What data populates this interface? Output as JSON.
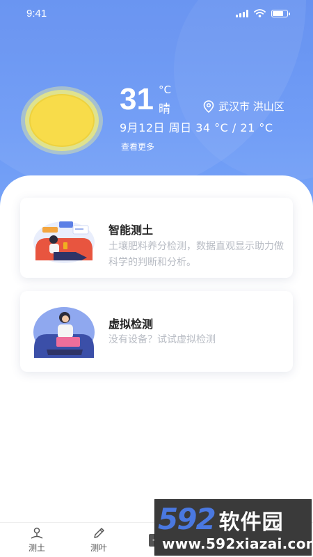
{
  "status_bar": {
    "time": "9:41",
    "battery_level": 0.8
  },
  "weather": {
    "temperature": "31",
    "unit": "°C",
    "condition": "晴",
    "location": "武汉市 洪山区",
    "date_line": "9月12日  周日 34 °C / 21 °C",
    "more_label": "查看更多",
    "icon": "sun-icon"
  },
  "cards": [
    {
      "title": "智能测土",
      "desc": "土壤肥料养分检测，数据直观显示助力做科学的判断和分析。",
      "icon": "woman-on-sofa-illustration"
    },
    {
      "title": "虚拟检测",
      "desc": "没有设备？试试虚拟检测",
      "icon": "woman-with-laptop-illustration"
    }
  ],
  "nav": [
    {
      "label": "测土",
      "icon": "soil-test-icon"
    },
    {
      "label": "测叶",
      "icon": "pencil-icon"
    },
    {
      "label": "",
      "icon": "group-icon"
    },
    {
      "label": "",
      "icon": "user-icon"
    }
  ],
  "watermark": {
    "number": "592",
    "name": "软件园",
    "url": "www.592xiazai.com"
  },
  "colors": {
    "header": "#6a98f6",
    "accent": "#4a78e0",
    "sun": "#f8dc4a"
  }
}
